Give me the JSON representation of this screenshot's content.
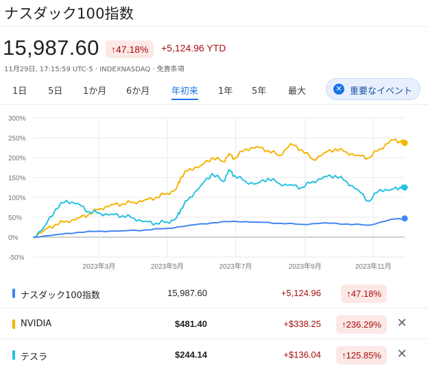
{
  "header": {
    "title": "ナスダック100指数",
    "price": "15,987.60",
    "change_pct": "↑47.18%",
    "change_abs": "+5,124.96 YTD",
    "meta": "11月29日, 17:15:59 UTC-5 · INDEXNASDAQ · 免責条項"
  },
  "ranges": [
    {
      "label": "1日",
      "active": false
    },
    {
      "label": "5日",
      "active": false
    },
    {
      "label": "1か月",
      "active": false
    },
    {
      "label": "6か月",
      "active": false
    },
    {
      "label": "年初来",
      "active": true
    },
    {
      "label": "1年",
      "active": false
    },
    {
      "label": "5年",
      "active": false
    },
    {
      "label": "最大",
      "active": false
    }
  ],
  "events_button": {
    "label": "重要なイベント",
    "icon": "close-circle-icon"
  },
  "colors": {
    "nasdaq": "#4285f4",
    "nvidia": "#f4b400",
    "tesla": "#24c1e0",
    "negative": "#a50e0e",
    "accent": "#1a73e8"
  },
  "chart_data": {
    "type": "line",
    "y_ticks": [
      "300%",
      "250%",
      "200%",
      "150%",
      "100%",
      "50%",
      "0%",
      "-50%"
    ],
    "ylim": [
      -50,
      300
    ],
    "x_ticks": [
      {
        "label": "2023年3月",
        "x": 59
      },
      {
        "label": "2023年5月",
        "x": 120
      },
      {
        "label": "2023年7月",
        "x": 181
      },
      {
        "label": "2023年9月",
        "x": 243
      },
      {
        "label": "2023年11月",
        "x": 304
      }
    ],
    "xlim": [
      0,
      332
    ],
    "series": [
      {
        "name": "NVIDIA",
        "key": "nvidia",
        "x": [
          0,
          10,
          20,
          30,
          40,
          50,
          60,
          70,
          80,
          90,
          100,
          110,
          120,
          128,
          132,
          140,
          150,
          160,
          170,
          175,
          180,
          190,
          200,
          210,
          220,
          230,
          240,
          250,
          260,
          270,
          280,
          290,
          300,
          310,
          320,
          328,
          332
        ],
        "y": [
          0,
          18,
          32,
          40,
          48,
          58,
          72,
          82,
          84,
          88,
          94,
          100,
          110,
          122,
          150,
          172,
          180,
          200,
          190,
          210,
          198,
          222,
          228,
          218,
          205,
          235,
          220,
          195,
          212,
          222,
          214,
          206,
          200,
          222,
          245,
          242,
          237
        ]
      },
      {
        "name": "テスラ",
        "key": "tesla",
        "x": [
          0,
          10,
          20,
          30,
          40,
          50,
          60,
          70,
          80,
          90,
          100,
          110,
          120,
          128,
          132,
          140,
          150,
          160,
          170,
          175,
          180,
          190,
          200,
          210,
          220,
          230,
          240,
          250,
          260,
          270,
          280,
          290,
          300,
          310,
          320,
          328,
          332
        ],
        "y": [
          0,
          25,
          70,
          92,
          85,
          64,
          60,
          58,
          54,
          48,
          40,
          35,
          38,
          48,
          70,
          100,
          130,
          160,
          140,
          170,
          155,
          140,
          135,
          148,
          135,
          132,
          125,
          140,
          152,
          155,
          140,
          120,
          90,
          120,
          120,
          126,
          125
        ]
      },
      {
        "name": "ナスダック100指数",
        "key": "nasdaq",
        "x": [
          0,
          20,
          40,
          60,
          80,
          100,
          120,
          140,
          160,
          180,
          200,
          220,
          240,
          260,
          280,
          300,
          320,
          332
        ],
        "y": [
          0,
          6,
          12,
          15,
          16,
          18,
          22,
          30,
          36,
          40,
          38,
          35,
          32,
          36,
          33,
          30,
          45,
          47
        ]
      }
    ]
  },
  "comparison": [
    {
      "key": "nasdaq",
      "name": "ナスダック100指数",
      "price": "15,987.60",
      "change": "+5,124.96",
      "pct": "↑47.18%",
      "removable": false
    },
    {
      "key": "nvidia",
      "name": "NVIDIA",
      "price": "$481.40",
      "change": "+$338.25",
      "pct": "↑236.29%",
      "removable": true
    },
    {
      "key": "tesla",
      "name": "テスラ",
      "price": "$244.14",
      "change": "+$136.04",
      "pct": "↑125.85%",
      "removable": true
    }
  ]
}
